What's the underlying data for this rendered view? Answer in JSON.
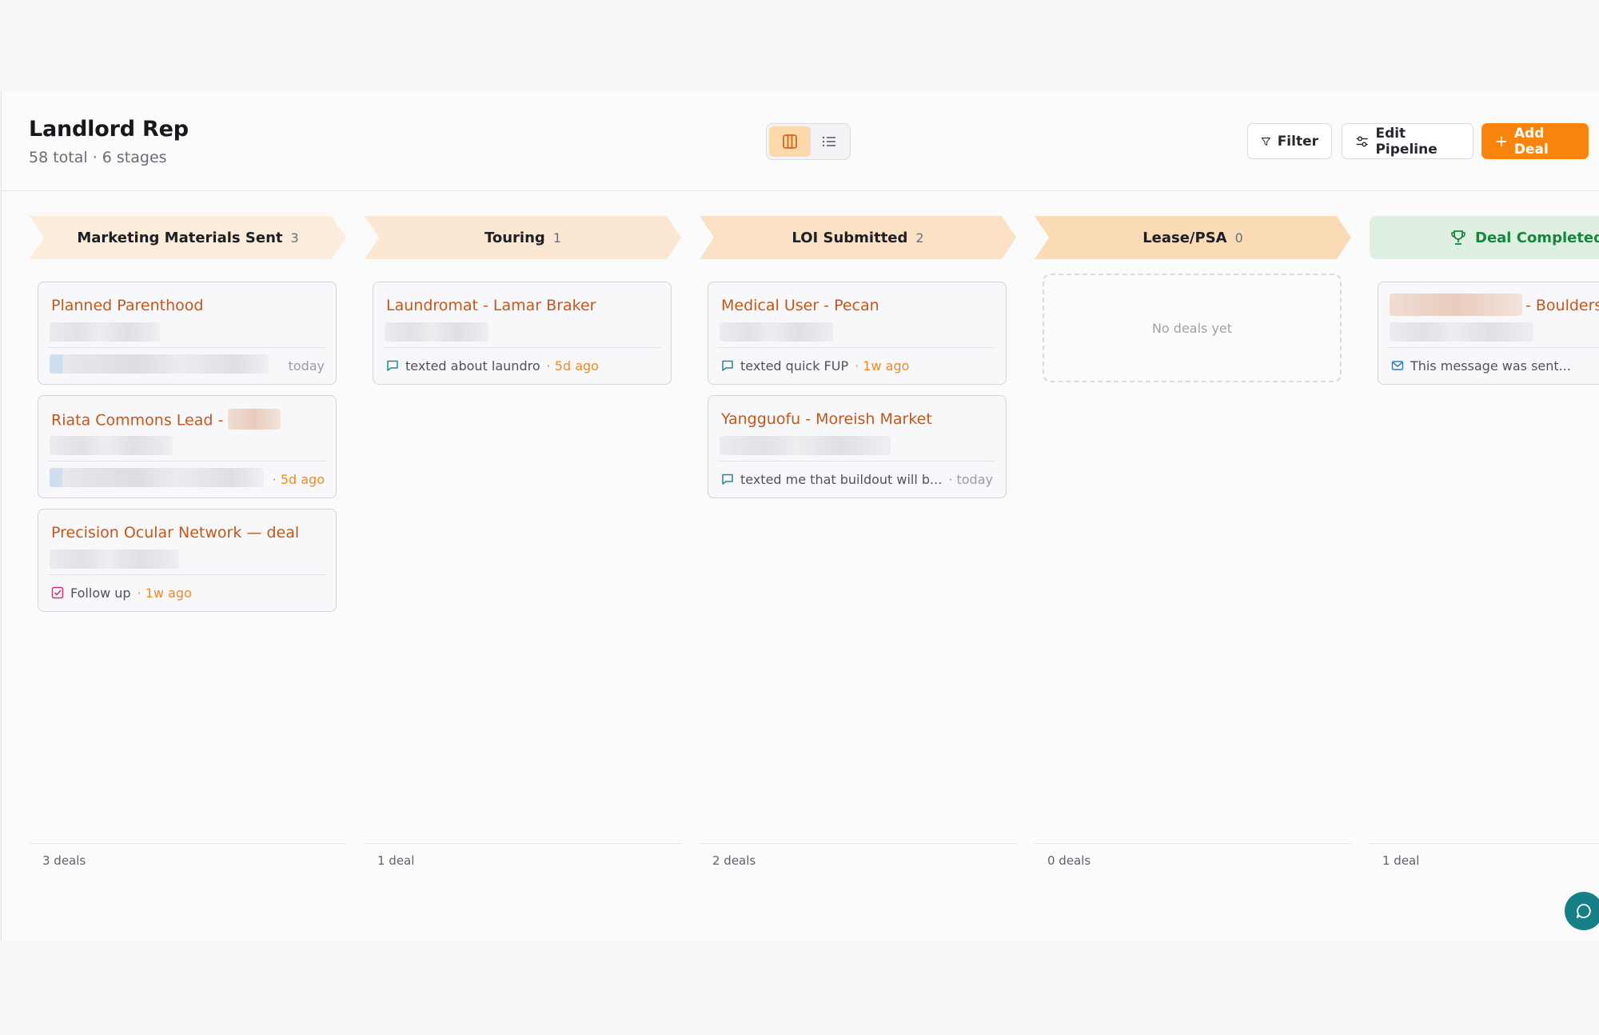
{
  "header": {
    "title": "Landlord Rep",
    "subtitle": "58 total · 6 stages",
    "filter_label": "Filter",
    "edit_label": "Edit Pipeline",
    "add_label": "Add Deal"
  },
  "colors": {
    "accent": "#f9840d",
    "deal_title": "#c2571b",
    "won": "#17863c"
  },
  "columns": [
    {
      "stage": "Marketing Materials Sent",
      "count": "3",
      "footer": "3 deals",
      "cards": [
        {
          "title": "Planned Parenthood",
          "note": "",
          "when": "today"
        },
        {
          "title": "Riata Commons Lead -",
          "note": "",
          "when": "· 5d ago"
        },
        {
          "title": "Precision Ocular Network — deal",
          "note": "Follow up",
          "when": "· 1w ago"
        }
      ]
    },
    {
      "stage": "Touring",
      "count": "1",
      "footer": "1 deal",
      "cards": [
        {
          "title": "Laundromat - Lamar Braker",
          "note": "texted about laundro",
          "when": "· 5d ago"
        }
      ]
    },
    {
      "stage": "LOI Submitted",
      "count": "2",
      "footer": "2 deals",
      "cards": [
        {
          "title": "Medical User - Pecan",
          "note": "texted quick FUP",
          "when": "· 1w ago"
        },
        {
          "title": "Yangguofu - Moreish Market",
          "note": "texted me that buildout will b...",
          "when": "· today"
        }
      ]
    },
    {
      "stage": "Lease/PSA",
      "count": "0",
      "footer": "0 deals",
      "empty": "No deals yet"
    },
    {
      "stage": "Deal Completed",
      "footer": "1 deal",
      "cards": [
        {
          "title": "- Boulders",
          "note": "This message was sent..."
        }
      ]
    }
  ]
}
